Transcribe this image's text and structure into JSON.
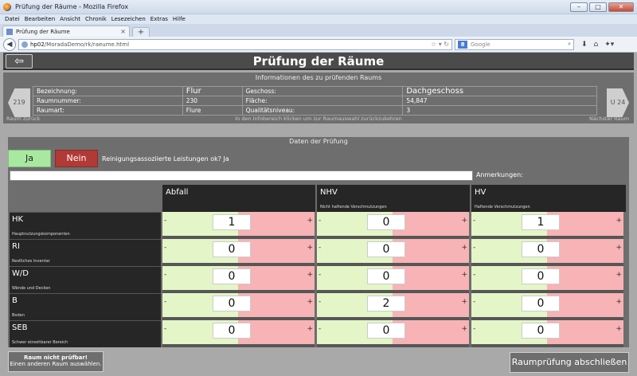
{
  "window": {
    "title": "Prüfung der Räume - Mozilla Firefox"
  },
  "menu": [
    "Datei",
    "Bearbeiten",
    "Ansicht",
    "Chronik",
    "Lesezeichen",
    "Extras",
    "Hilfe"
  ],
  "tab": {
    "title": "Prüfung der Räume"
  },
  "url": {
    "host": "hp02",
    "path": "/MoradaDemo/rk/raeume.html"
  },
  "search": {
    "placeholder": "Google",
    "engine": "8"
  },
  "app": {
    "title": "Prüfung der Räume",
    "back_glyph": "⇦"
  },
  "info": {
    "title": "Informationen des zu prüfenden Raums",
    "prev_room": "219",
    "next_room": "U 24",
    "rows": [
      {
        "l1": "Bezeichnung:",
        "v1": "Flur",
        "l2": "Geschoss:",
        "v2": "Dachgeschoss"
      },
      {
        "l1": "Raumnummer:",
        "v1": "230",
        "l2": "Fläche:",
        "v2": "54,847"
      },
      {
        "l1": "Raumart:",
        "v1": "Flure",
        "l2": "Qualitätsniveau:",
        "v2": "3"
      }
    ],
    "hint_left": "Raum zurück",
    "hint_center": "In den Infobereich klicken um zur Raumauswahl zurückzukehren",
    "hint_right": "Nächster Raum"
  },
  "data": {
    "title": "Daten der Prüfung",
    "yes_label": "Ja",
    "no_label": "Nein",
    "question": "Reinigungsassoziierte Leistungen ok? Ja",
    "notes_label": "Anmerkungen:",
    "columns": [
      {
        "name": "Abfall",
        "sub": ""
      },
      {
        "name": "NHV",
        "sub": "Nicht haftende Verschmutzungen"
      },
      {
        "name": "HV",
        "sub": "Haftende Verschmutzungen"
      }
    ],
    "rows": [
      {
        "code": "HK",
        "desc": "Hauptnutzungskomponenten",
        "values": [
          "1",
          "0",
          "1"
        ]
      },
      {
        "code": "RI",
        "desc": "Restliches Inventar",
        "values": [
          "0",
          "0",
          "0"
        ]
      },
      {
        "code": "W/D",
        "desc": "Wände und Decken",
        "values": [
          "0",
          "0",
          "0"
        ]
      },
      {
        "code": "B",
        "desc": "Boden",
        "values": [
          "0",
          "2",
          "0"
        ]
      },
      {
        "code": "SEB",
        "desc": "Schwer einsehbarer Bereich",
        "values": [
          "0",
          "0",
          "0"
        ]
      }
    ],
    "minus": "-",
    "plus": "+"
  },
  "footer": {
    "not_testable_1": "Raum nicht prüfbar!",
    "not_testable_2": "Einen anderen Raum auswählen.",
    "finish": "Raumprüfung abschließen"
  }
}
